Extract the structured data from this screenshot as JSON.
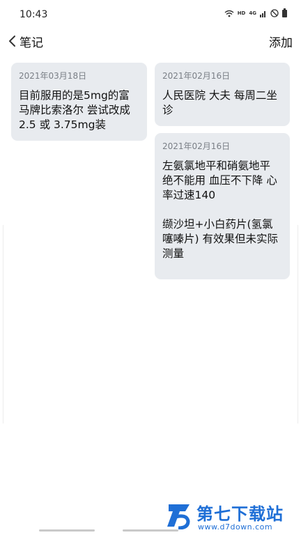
{
  "status": {
    "time": "10:43",
    "hd": "HD",
    "net": "4G"
  },
  "appbar": {
    "title": "笔记",
    "add_label": "添加"
  },
  "notes_left": [
    {
      "date": "2021年03月18日",
      "text": "目前服用的是5mg的富马牌比索洛尔 尝试改成2.5 或 3.75mg装"
    }
  ],
  "notes_right": [
    {
      "date": "2021年02月16日",
      "text": "人民医院 大夫 每周二坐诊"
    },
    {
      "date": "2021年02月16日",
      "text": "左氨氯地平和硝氨地平 绝不能用 血压不下降 心率过速140\n\n缬沙坦+小白药片(氢氯噻嗪片) 有效果但未实际测量"
    }
  ],
  "watermark": {
    "brand": "第七下载站",
    "url": "www.d7down.com"
  },
  "colors": {
    "card_bg": "#e8ebef",
    "date_text": "#7a7f86",
    "watermark_blue": "#1f6fd6"
  }
}
